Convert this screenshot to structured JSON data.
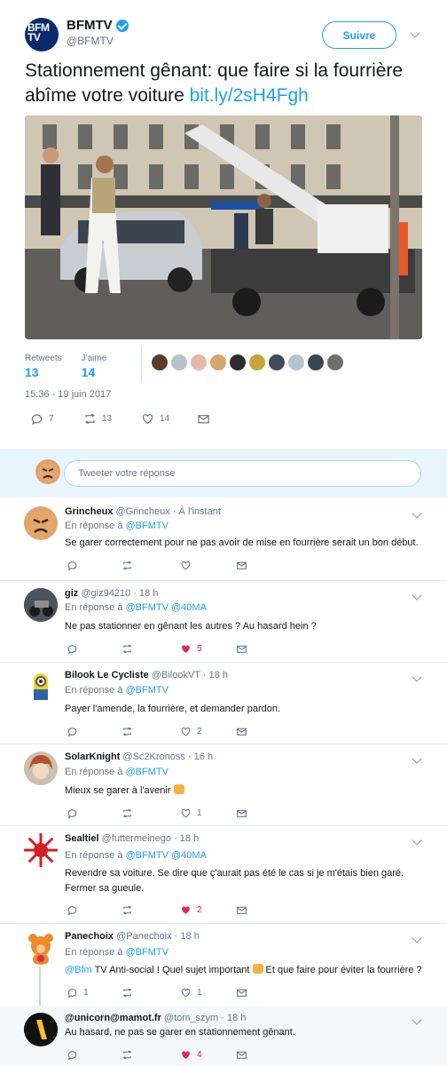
{
  "main": {
    "name": "BFMTV",
    "handle": "@BFMTV",
    "logo_text": "BFM TV",
    "follow_label": "Suivre",
    "text": "Stationnement gênant: que faire si la fourrière abîme votre voiture",
    "link": "bit.ly/2sH4Fgh",
    "retweets_label": "Retweets",
    "retweets_value": "13",
    "likes_label": "J'aime",
    "likes_value": "14",
    "date": "15:36 - 19 juin 2017",
    "reply_count": "7",
    "retweet_count": "13",
    "like_count": "14"
  },
  "reply_box": {
    "placeholder": "Tweeter votre réponse"
  },
  "replies": [
    {
      "name": "Grincheux",
      "meta": "@Grincheux · À l'instant",
      "in_reply_prefix": "En réponse à",
      "in_reply_mentions": "@BFMTV",
      "text": "Se garer correctement pour ne pas avoir de mise en fourrière serait un bon début.",
      "likes": ""
    },
    {
      "name": "giz",
      "meta": "@giz94210 · 18 h",
      "in_reply_prefix": "En réponse à",
      "in_reply_mentions": "@BFMTV @40MA",
      "text": "Ne pas stationner en gênant les autres ? Au hasard hein ?",
      "likes": "5"
    },
    {
      "name": "Bilook Le Cycliste",
      "meta": "@BilookVT · 18 h",
      "in_reply_prefix": "En réponse à",
      "in_reply_mentions": "@BFMTV",
      "text": "Payer l'amende, la fourrière, et demander pardon.",
      "likes": "2"
    },
    {
      "name": "SolarKnight",
      "meta": "@Sc2Kronoss · 16 h",
      "in_reply_prefix": "En réponse à",
      "in_reply_mentions": "@BFMTV",
      "text": "Mieux se garer à l'avenir",
      "likes": "1"
    },
    {
      "name": "Sealtiel",
      "meta": "@futtermeinego · 18 h",
      "in_reply_prefix": "En réponse à",
      "in_reply_mentions": "@BFMTV @40MA",
      "text": "Revendre sa voiture. Se dire que ç'aurait pas été le cas si je m'étais bien garé.",
      "text2": "Fermer sa gueule.",
      "likes": "2"
    },
    {
      "name": "Panechoix",
      "meta": "@Panechoix · 18 h",
      "in_reply_prefix": "En réponse à",
      "in_reply_mentions": "@BFMTV",
      "text_mention": "@Bfm",
      "text": " TV Anti-social ! Quel sujet important ",
      "text_after": " Et que faire pour éviter la fourrière ?",
      "replies": "1",
      "likes": "1"
    },
    {
      "name": "@unicorn@mamot.fr",
      "meta": "@tom_szym · 18 h",
      "text": "Au hasard, ne pas se garer en stationnement gênant.",
      "likes": "4"
    }
  ],
  "colors": {
    "accent": "#1da1f2",
    "like": "#e0245e",
    "muted": "#657786"
  }
}
